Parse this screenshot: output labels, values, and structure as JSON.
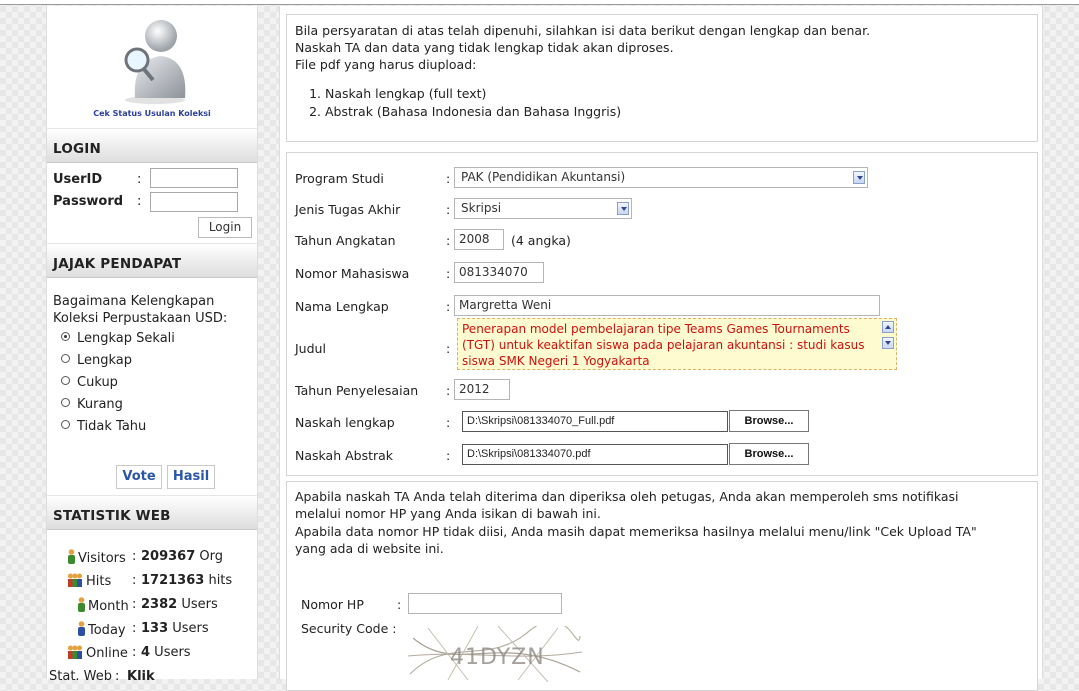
{
  "sidebar": {
    "logo_caption": "Cek Status Usulan Koleksi",
    "login": {
      "header": "LOGIN",
      "userid_label": "UserID",
      "password_label": "Password",
      "separator": ":",
      "userid_value": "",
      "password_value": "",
      "login_button": "Login"
    },
    "poll": {
      "header": "JAJAK PENDAPAT",
      "question": "Bagaimana Kelengkapan Koleksi Perpustakaan USD:",
      "options": [
        {
          "label": "Lengkap Sekali",
          "selected": true
        },
        {
          "label": "Lengkap",
          "selected": false
        },
        {
          "label": "Cukup",
          "selected": false
        },
        {
          "label": "Kurang",
          "selected": false
        },
        {
          "label": "Tidak Tahu",
          "selected": false
        }
      ],
      "vote_button": "Vote",
      "result_button": "Hasil"
    },
    "stats": {
      "header": "STATISTIK WEB",
      "rows": [
        {
          "label": "Visitors",
          "sep": ":",
          "value": "209367",
          "unit": " Org",
          "icon": "person-icon"
        },
        {
          "label": "Hits",
          "sep": ":",
          "value": "1721363",
          "unit": " hits",
          "icon": "group-icon"
        },
        {
          "label": "Month",
          "sep": ":",
          "value": "2382",
          "unit": " Users",
          "icon": "person-icon"
        },
        {
          "label": "Today",
          "sep": ":",
          "value": "133",
          "unit": " Users",
          "icon": "person-icon"
        },
        {
          "label": "Online",
          "sep": ":",
          "value": "4",
          "unit": " Users",
          "icon": "group-icon"
        },
        {
          "label": "Stat. Web",
          "sep": ":",
          "value": "Klik",
          "unit": "",
          "icon": ""
        }
      ]
    }
  },
  "intro": {
    "line1": "Bila persyaratan di atas telah dipenuhi, silahkan isi data berikut dengan lengkap dan benar.",
    "line2": "Naskah TA dan data yang tidak lengkap tidak akan diproses.",
    "line3": "File pdf yang harus diupload:",
    "requirements": [
      "Naskah lengkap (full text)",
      "Abstrak (Bahasa Indonesia dan Bahasa Inggris)"
    ]
  },
  "form": {
    "separator": ":",
    "program_studi": {
      "label": "Program Studi",
      "value": "PAK (Pendidikan Akuntansi)"
    },
    "jenis_ta": {
      "label": "Jenis Tugas Akhir",
      "value": "Skripsi"
    },
    "tahun_angkatan": {
      "label": "Tahun Angkatan",
      "value": "2008",
      "hint": "(4 angka)"
    },
    "nomor_mhs": {
      "label": "Nomor Mahasiswa",
      "value": "081334070"
    },
    "nama": {
      "label": "Nama Lengkap",
      "value": "Margretta Weni"
    },
    "judul": {
      "label": "Judul",
      "value": "Penerapan model pembelajaran tipe Teams Games Tournaments (TGT) untuk keaktifan siswa pada pelajaran akuntansi : studi kasus siswa SMK Negeri 1 Yogyakarta"
    },
    "tahun_selesai": {
      "label": "Tahun Penyelesaian",
      "value": "2012"
    },
    "naskah_lengkap": {
      "label": "Naskah lengkap",
      "value": "D:\\Skripsi\\081334070_Full.pdf"
    },
    "naskah_abstrak": {
      "label": "Naskah Abstrak",
      "value": "D:\\Skripsi\\081334070.pdf"
    },
    "browse_label": "Browse..."
  },
  "notice": {
    "line1": "Apabila naskah TA Anda telah diterima dan diperiksa oleh petugas, Anda akan memperoleh sms notifikasi",
    "line2": "melalui nomor HP yang Anda isikan di bawah ini.",
    "line3": "Apabila data nomor HP tidak diisi, Anda masih dapat memeriksa hasilnya melalui menu/link \"Cek Upload TA\"",
    "line4": "yang ada di website ini.",
    "hp_label": "Nomor HP",
    "hp_sep": ":",
    "hp_value": "",
    "security_label": "Security Code :",
    "captcha_text": "41DYZN"
  }
}
